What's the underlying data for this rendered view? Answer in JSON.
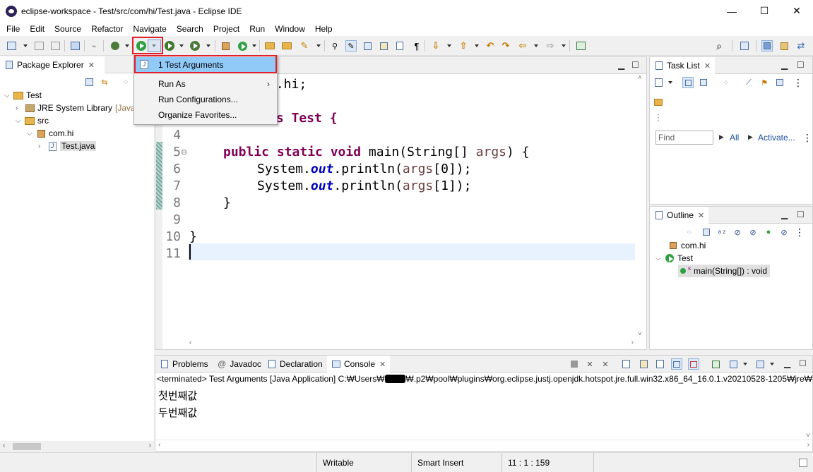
{
  "window": {
    "title": "eclipse-workspace - Test/src/com/hi/Test.java - Eclipse IDE",
    "controls": {
      "minimize": "—",
      "maximize": "☐",
      "close": "✕"
    }
  },
  "menu": [
    "File",
    "Edit",
    "Source",
    "Refactor",
    "Navigate",
    "Search",
    "Project",
    "Run",
    "Window",
    "Help"
  ],
  "run_dropdown": {
    "items": [
      "1 Test Arguments",
      "Run As",
      "Run Configurations...",
      "Organize Favorites..."
    ],
    "highlighted": "1 Test Arguments",
    "submenu_arrow": "›"
  },
  "package_explorer": {
    "tab": "Package Explorer",
    "tree": {
      "project": "Test",
      "jre": "JRE System Library",
      "jre_suffix": "[Java",
      "src": "src",
      "package": "com.hi",
      "file": "Test.java"
    }
  },
  "editor": {
    "line_numbers": [
      "4",
      "5",
      "6",
      "7",
      "8",
      "9",
      "10",
      "11"
    ],
    "partial_lines": {
      "pkg_tail": "m.hi;",
      "class_tail": "ss Test {"
    },
    "code": {
      "line5_kw": "public static void",
      "line5_rest": " main(String[] ",
      "line5_var": "args",
      "line5_end": ") {",
      "line6_a": "System.",
      "line6_fld": "out",
      "line6_b": ".println(",
      "line6_var": "args",
      "line6_c": "[0]);",
      "line7_a": "System.",
      "line7_fld": "out",
      "line7_b": ".println(",
      "line7_var": "args",
      "line7_c": "[1]);",
      "line8": "}",
      "line10": "}"
    },
    "fold_marker": "⊖"
  },
  "task_list": {
    "tab": "Task List",
    "find_placeholder": "Find",
    "all_label": "All",
    "activate_label": "Activate...",
    "arrow": "▶"
  },
  "outline": {
    "tab": "Outline",
    "items": [
      "com.hi",
      "Test",
      "main(String[]) : void"
    ],
    "sort_label": "a z"
  },
  "bottom_tabs": {
    "problems": "Problems",
    "javadoc": "Javadoc",
    "declaration": "Declaration",
    "console": "Console",
    "javadoc_prefix": "@"
  },
  "console": {
    "header": "<terminated> Test Arguments [Java Application] C:₩Users₩",
    "header_rest": "₩.p2₩pool₩plugins₩org.eclipse.justj.openjdk.hotspot.jre.full.win32.x86_64_16.0.1.v20210528-1205₩jre₩",
    "output": [
      "첫번째값",
      "두번째값"
    ]
  },
  "status_bar": {
    "writable": "Writable",
    "insert_mode": "Smart Insert",
    "position": "11 : 1 : 159"
  },
  "colors": {
    "keyword": "#7f0055",
    "field": "#0000c0",
    "variable": "#6a3e3e",
    "highlight": "#91c9f7",
    "red_frame": "#e0202a"
  }
}
